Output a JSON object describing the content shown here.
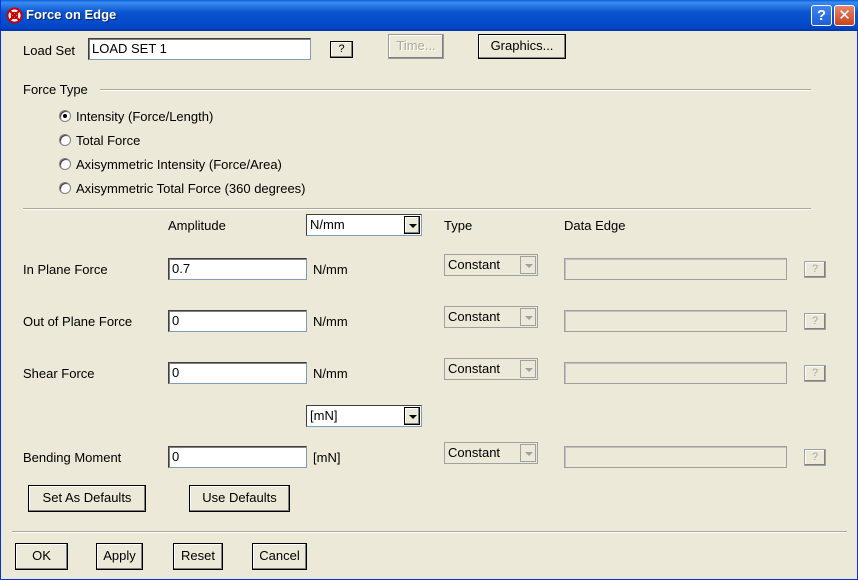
{
  "window": {
    "title": "Force on Edge"
  },
  "load_set": {
    "label": "Load Set",
    "value": "LOAD SET 1",
    "help": "?",
    "time_button": "Time...",
    "graphics_button": "Graphics..."
  },
  "force_type": {
    "label": "Force Type",
    "options": [
      {
        "label": "Intensity (Force/Length)",
        "selected": true
      },
      {
        "label": "Total Force",
        "selected": false
      },
      {
        "label": "Axisymmetric Intensity (Force/Area)",
        "selected": false
      },
      {
        "label": "Axisymmetric Total Force (360 degrees)",
        "selected": false
      }
    ]
  },
  "headers": {
    "amplitude": "Amplitude",
    "type": "Type",
    "data_edge": "Data Edge"
  },
  "units": {
    "force_unit": "N/mm",
    "moment_unit": "[mN]"
  },
  "rows": [
    {
      "label": "In Plane Force",
      "value": "0.7",
      "unit": "N/mm",
      "type": "Constant",
      "help": "?"
    },
    {
      "label": "Out of Plane Force",
      "value": "0",
      "unit": "N/mm",
      "type": "Constant",
      "help": "?"
    },
    {
      "label": "Shear Force",
      "value": "0",
      "unit": "N/mm",
      "type": "Constant",
      "help": "?"
    },
    {
      "label": "Bending Moment",
      "value": "0",
      "unit": "[mN]",
      "type": "Constant",
      "help": "?"
    }
  ],
  "defaults": {
    "set_as": "Set As Defaults",
    "use": "Use Defaults"
  },
  "footer": {
    "ok": "OK",
    "apply": "Apply",
    "reset": "Reset",
    "cancel": "Cancel"
  },
  "colors": {
    "titlebar": "#0a54d0",
    "face": "#ece9d8"
  }
}
